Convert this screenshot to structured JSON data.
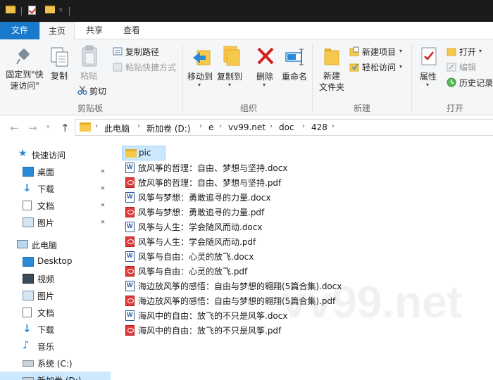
{
  "ribbon_tabs": {
    "file": "文件",
    "home": "主页",
    "share": "共享",
    "view": "查看"
  },
  "ribbon": {
    "pin_quick_access": [
      "固定到\"快",
      "速访问\""
    ],
    "copy": "复制",
    "paste": "粘贴",
    "copy_path": "复制路径",
    "paste_shortcut": "粘贴快捷方式",
    "cut": "剪切",
    "clipboard_group": "剪贴板",
    "move_to": "移动到",
    "copy_to": "复制到",
    "delete": "删除",
    "rename": "重命名",
    "organize_group": "组织",
    "new_folder": [
      "新建",
      "文件夹"
    ],
    "new_item": "新建项目",
    "easy_access": "轻松访问",
    "new_group": "新建",
    "properties": "属性",
    "open": "打开",
    "edit": "编辑",
    "history": "历史记录",
    "open_group": "打开"
  },
  "breadcrumb": [
    "此电脑",
    "新加卷 (D:)",
    "e",
    "vv99.net",
    "doc",
    "428"
  ],
  "nav_pane": {
    "quick_access": "快速访问",
    "quick_items": [
      "桌面",
      "下载",
      "文档",
      "图片"
    ],
    "this_pc": "此电脑",
    "pc_items": [
      "Desktop",
      "视频",
      "图片",
      "文档",
      "下载",
      "音乐",
      "系统 (C:)",
      "新加卷 (D:)"
    ]
  },
  "files": [
    {
      "name": "pic",
      "type": "folder"
    },
    {
      "name": "放风筝的哲理：自由、梦想与坚持.docx",
      "type": "docx"
    },
    {
      "name": "放风筝的哲理：自由、梦想与坚持.pdf",
      "type": "pdf"
    },
    {
      "name": "风筝与梦想：勇敢追寻的力量.docx",
      "type": "docx"
    },
    {
      "name": "风筝与梦想：勇敢追寻的力量.pdf",
      "type": "pdf"
    },
    {
      "name": "风筝与人生：学会随风而动.docx",
      "type": "docx"
    },
    {
      "name": "风筝与人生：学会随风而动.pdf",
      "type": "pdf"
    },
    {
      "name": "风筝与自由：心灵的放飞.docx",
      "type": "docx"
    },
    {
      "name": "风筝与自由：心灵的放飞.pdf",
      "type": "pdf"
    },
    {
      "name": "海边放风筝的感悟：自由与梦想的翱翔(5篇合集).docx",
      "type": "docx"
    },
    {
      "name": "海边放风筝的感悟：自由与梦想的翱翔(5篇合集).pdf",
      "type": "pdf"
    },
    {
      "name": "海风中的自由：放飞的不只是风筝.docx",
      "type": "docx"
    },
    {
      "name": "海风中的自由：放飞的不只是风筝.pdf",
      "type": "pdf"
    }
  ],
  "watermark": "vv99.net",
  "colors": {
    "accent": "#1979ca",
    "selection": "#cce8ff",
    "folder": "#f6c94d",
    "pdf": "#e03a3a",
    "word": "#2b579a"
  }
}
